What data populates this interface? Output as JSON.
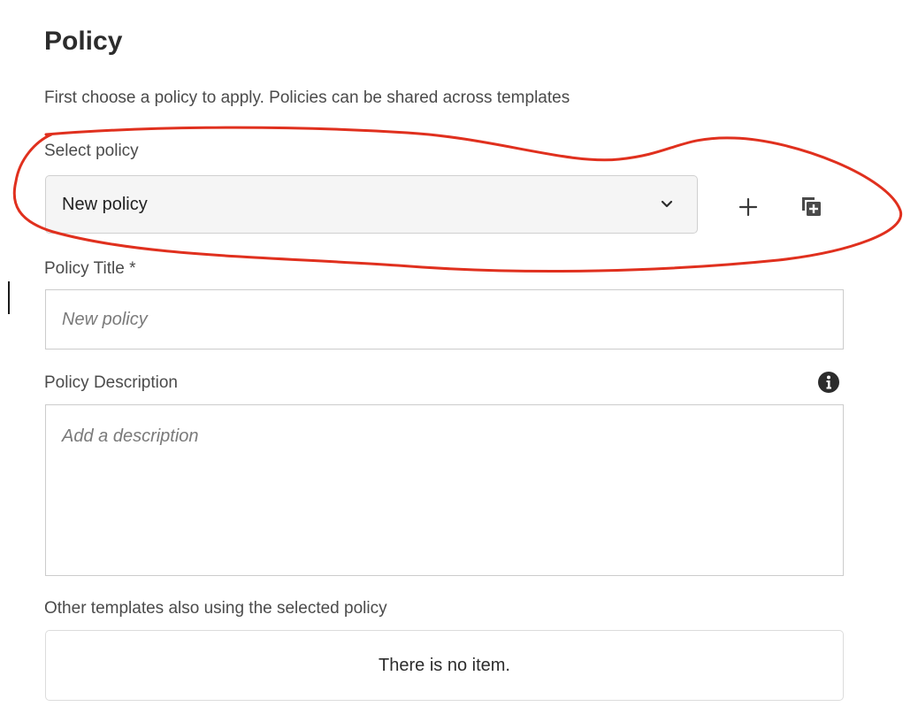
{
  "policy": {
    "heading": "Policy",
    "intro": "First choose a policy to apply. Policies can be shared across templates",
    "select": {
      "label": "Select policy",
      "value": "New policy",
      "chevron_icon": "chevron-down-icon",
      "add_icon": "plus-icon",
      "copy_icon": "duplicate-add-icon"
    },
    "title_field": {
      "label": "Policy Title *",
      "placeholder": "New policy"
    },
    "description_field": {
      "label": "Policy Description",
      "placeholder": "Add a description",
      "info_icon": "info-icon"
    },
    "other_templates": {
      "label": "Other templates also using the selected policy",
      "empty_text": "There is no item."
    }
  },
  "annotation": {
    "shape": "hand-drawn-ellipse",
    "color": "#e0301e"
  }
}
